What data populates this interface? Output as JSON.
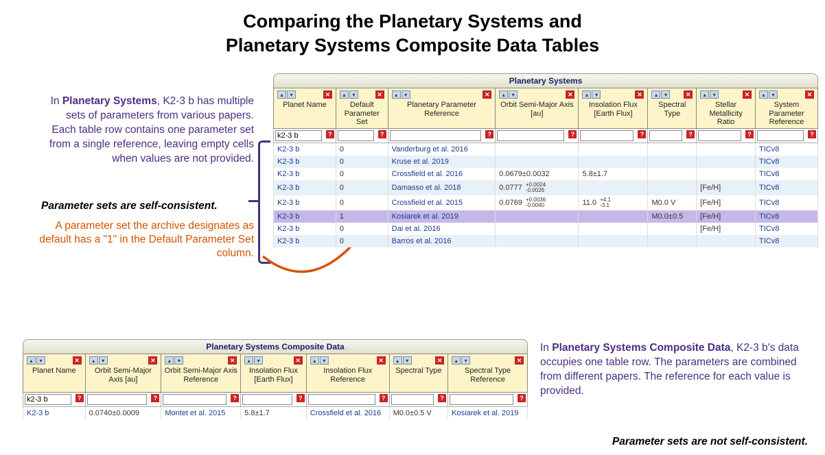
{
  "title_line1": "Comparing the Planetary Systems and",
  "title_line2": "Planetary Systems Composite Data Tables",
  "tab1": "Planetary Systems",
  "tab2": "Planetary Systems Composite Data",
  "annotation_left": {
    "prefix": "In ",
    "bold": "Planetary Systems",
    "rest": ", K2-3 b has multiple sets of parameters from various papers. Each table row contains one parameter set from a single reference, leaving empty cells when values are not provided."
  },
  "self_consistent": "Parameter sets are self-consistent.",
  "orange_note": "A parameter set the archive designates as default has a \"1\" in the Default Parameter Set column.",
  "annotation_right": {
    "prefix": "In ",
    "bold": "Planetary Systems Composite Data",
    "rest": ", K2-3 b's data occupies one table row. The parameters are combined from different papers. The reference for each value is provided."
  },
  "not_consistent": "Parameter sets are not self-consistent.",
  "table1": {
    "columns": [
      "Planet Name",
      "Default Parameter Set",
      "Planetary Parameter Reference",
      "Orbit Semi-Major Axis [au]",
      "Insolation Flux [Earth Flux]",
      "Spectral Type",
      "Stellar Metallicity Ratio",
      "System Parameter Reference"
    ],
    "widths": [
      90,
      75,
      155,
      120,
      100,
      70,
      85,
      90
    ],
    "filter_value": "k2-3 b",
    "rows": [
      {
        "name": "K2-3 b",
        "def": "0",
        "ref": "Vanderburg et al. 2016",
        "axis": "",
        "flux": "",
        "spec": "",
        "metal": "",
        "sysref": "TICv8"
      },
      {
        "name": "K2-3 b",
        "def": "0",
        "ref": "Kruse et al. 2019",
        "axis": "",
        "flux": "",
        "spec": "",
        "metal": "",
        "sysref": "TICv8"
      },
      {
        "name": "K2-3 b",
        "def": "0",
        "ref": "Crossfield et al. 2016",
        "axis": "0.0679±0.0032",
        "flux": "5.8±1.7",
        "spec": "",
        "metal": "",
        "sysref": "TICv8"
      },
      {
        "name": "K2-3 b",
        "def": "0",
        "ref": "Damasso et al. 2018",
        "axis": "0.0777",
        "axis_sup": "+0.0024",
        "axis_sub": "-0.0026",
        "flux": "",
        "spec": "",
        "metal": "[Fe/H]",
        "sysref": "TICv8"
      },
      {
        "name": "K2-3 b",
        "def": "0",
        "ref": "Crossfield et al. 2015",
        "axis": "0.0769",
        "axis_sup": "+0.0036",
        "axis_sub": "-0.0040",
        "flux": "11.0",
        "flux_sup": "+4.1",
        "flux_sub": "-3.1",
        "spec": "M0.0 V",
        "metal": "[Fe/H]",
        "sysref": "TICv8"
      },
      {
        "name": "K2-3 b",
        "def": "1",
        "ref": "Kosiarek et al. 2019",
        "axis": "",
        "flux": "",
        "spec": "M0.0±0.5",
        "metal": "[Fe/H]",
        "sysref": "TICv8",
        "highlight": true
      },
      {
        "name": "K2-3 b",
        "def": "0",
        "ref": "Dai et al. 2016",
        "axis": "",
        "flux": "",
        "spec": "",
        "metal": "[Fe/H]",
        "sysref": "TICv8"
      },
      {
        "name": "K2-3 b",
        "def": "0",
        "ref": "Barros et al. 2016",
        "axis": "",
        "flux": "",
        "spec": "",
        "metal": "",
        "sysref": "TICv8"
      }
    ]
  },
  "table2": {
    "columns": [
      "Planet Name",
      "Orbit Semi-Major Axis [au]",
      "Orbit Semi-Major Axis Reference",
      "Insolation Flux [Earth Flux]",
      "Insolation Flux Reference",
      "Spectral Type",
      "Spectral Type Reference"
    ],
    "widths": [
      90,
      110,
      115,
      95,
      120,
      85,
      115
    ],
    "filter_value": "k2-3 b",
    "rows": [
      {
        "name": "K2-3 b",
        "axis": "0.0740±0.0009",
        "axisref": "Montet et al. 2015",
        "flux": "5.8±1.7",
        "fluxref": "Crossfield et al. 2016",
        "spec": "M0.0±0.5 V",
        "specref": "Kosiarek et al. 2019"
      }
    ]
  }
}
